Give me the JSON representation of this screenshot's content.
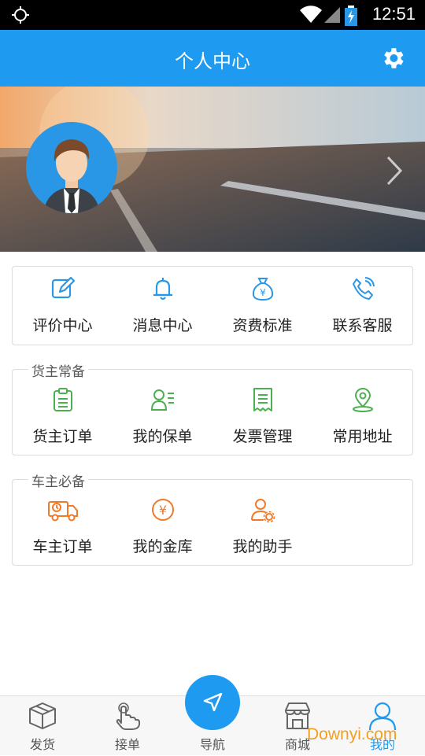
{
  "status": {
    "time": "12:51"
  },
  "header": {
    "title": "个人中心",
    "settings_icon": "gear-icon"
  },
  "banner": {
    "avatar_icon": "avatar",
    "arrow_icon": "chevron-right-icon"
  },
  "services": [
    {
      "label": "评价中心",
      "icon": "edit-icon"
    },
    {
      "label": "消息中心",
      "icon": "bell-icon"
    },
    {
      "label": "资费标准",
      "icon": "money-bag-icon"
    },
    {
      "label": "联系客服",
      "icon": "phone-icon"
    }
  ],
  "shipper": {
    "title": "货主常备",
    "items": [
      {
        "label": "货主订单",
        "icon": "clipboard-icon"
      },
      {
        "label": "我的保单",
        "icon": "policy-icon"
      },
      {
        "label": "发票管理",
        "icon": "invoice-icon"
      },
      {
        "label": "常用地址",
        "icon": "location-icon"
      }
    ]
  },
  "carrier": {
    "title": "车主必备",
    "items": [
      {
        "label": "车主订单",
        "icon": "truck-icon"
      },
      {
        "label": "我的金库",
        "icon": "yen-icon"
      },
      {
        "label": "我的助手",
        "icon": "assistant-icon"
      }
    ]
  },
  "tabs": [
    {
      "label": "发货",
      "icon": "box-icon"
    },
    {
      "label": "接单",
      "icon": "hand-icon"
    },
    {
      "label": "导航",
      "icon": "navigation-icon"
    },
    {
      "label": "商城",
      "icon": "store-icon"
    },
    {
      "label": "我的",
      "icon": "user-icon",
      "active": true
    }
  ],
  "watermark": "Downyi.com",
  "colors": {
    "primary": "#1e9bf0",
    "blue_icon": "#2a97e6",
    "green_icon": "#4caf50",
    "orange_icon": "#f07a2a"
  }
}
